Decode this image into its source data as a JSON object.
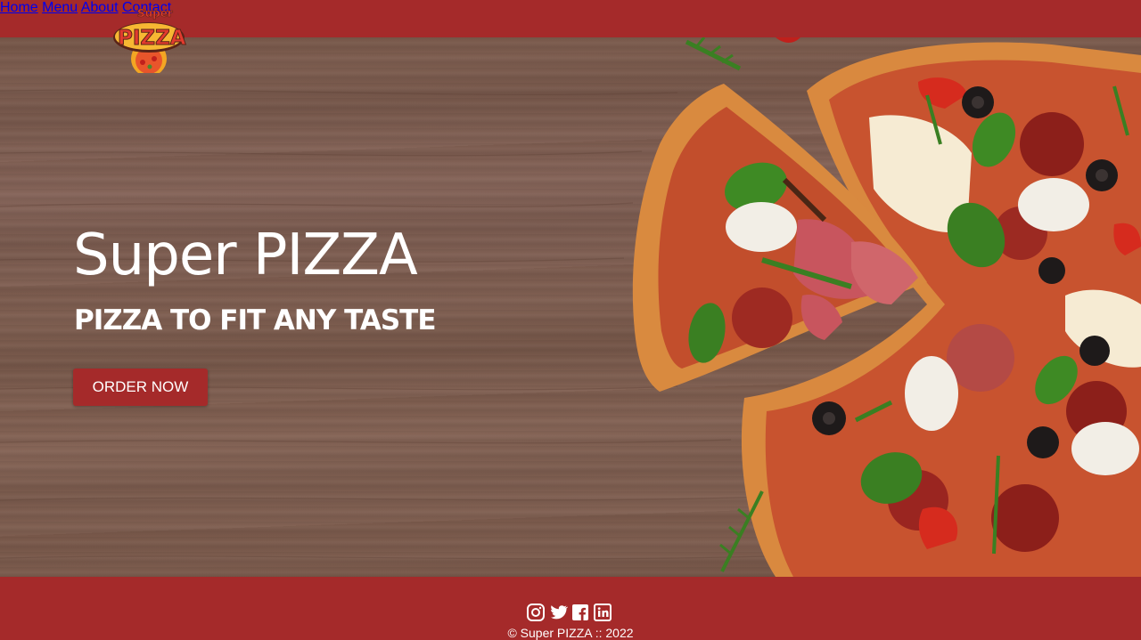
{
  "header": {
    "logo_text_top": "Super",
    "logo_text_main": "PIZZA",
    "nav": [
      {
        "label": "Home"
      },
      {
        "label": "Menu"
      },
      {
        "label": "About"
      },
      {
        "label": "Contact"
      }
    ]
  },
  "hero": {
    "title": "Super PIZZA",
    "subtitle": "PIZZA TO FIT ANY TASTE",
    "cta_label": "ORDER NOW"
  },
  "footer": {
    "social_icons": [
      "instagram-icon",
      "twitter-icon",
      "facebook-icon",
      "linkedin-icon"
    ],
    "copyright": "© Super PIZZA :: 2022"
  },
  "colors": {
    "brand_red": "#a52a2a",
    "wood": "#7e5e50",
    "text": "#ffffff"
  }
}
